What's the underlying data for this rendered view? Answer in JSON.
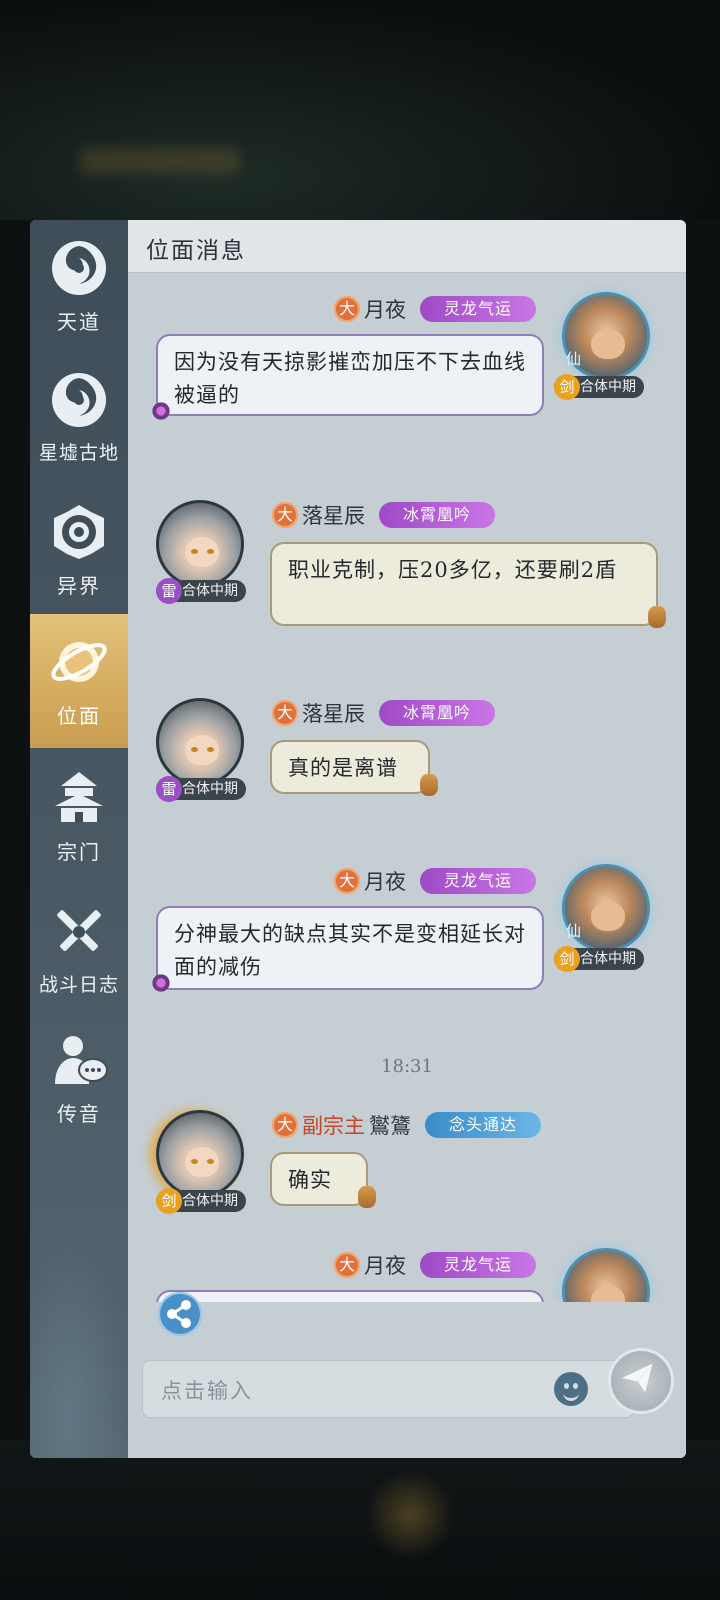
{
  "panel_title": "位面消息",
  "sidebar": {
    "items": [
      {
        "label": "天道",
        "icon": "swirl-icon",
        "active": false
      },
      {
        "label": "星墟古地",
        "icon": "swirl-icon",
        "active": false
      },
      {
        "label": "异界",
        "icon": "portal-icon",
        "active": false
      },
      {
        "label": "位面",
        "icon": "planet-icon",
        "active": true
      },
      {
        "label": "宗门",
        "icon": "pagoda-icon",
        "active": false
      },
      {
        "label": "战斗日志",
        "icon": "crossed-swords-icon",
        "active": false
      },
      {
        "label": "传音",
        "icon": "chat-person-icon",
        "active": false
      }
    ]
  },
  "messages": [
    {
      "side": "right",
      "badge": "大",
      "role": "",
      "name": "月夜",
      "title": "灵龙气运",
      "title_color": "purple",
      "rank_icon": "剑",
      "rank": "合体中期",
      "text": "因为没有天掠影摧峦加压不下去血线被逼的"
    },
    {
      "side": "left",
      "badge": "大",
      "role": "",
      "name": "落星辰",
      "title": "冰霄凰吟",
      "title_color": "purple",
      "rank_icon": "雷",
      "rank": "合体中期",
      "text": "职业克制，压20多亿，还要刷2盾"
    },
    {
      "side": "left",
      "badge": "大",
      "role": "",
      "name": "落星辰",
      "title": "冰霄凰吟",
      "title_color": "purple",
      "rank_icon": "雷",
      "rank": "合体中期",
      "text": "真的是离谱"
    },
    {
      "side": "right",
      "badge": "大",
      "role": "",
      "name": "月夜",
      "title": "灵龙气运",
      "title_color": "purple",
      "rank_icon": "剑",
      "rank": "合体中期",
      "text": "分神最大的缺点其实不是变相延长对面的减伤"
    },
    {
      "side": "left",
      "badge": "大",
      "role": "副宗主",
      "name": "鸑鷟",
      "title": "念头通达",
      "title_color": "blue",
      "rank_icon": "剑",
      "rank": "合体中期",
      "text": "确实"
    },
    {
      "side": "right",
      "badge": "大",
      "role": "",
      "name": "月夜",
      "title": "灵龙气运",
      "title_color": "purple",
      "rank_icon": "",
      "rank": "",
      "text": ""
    }
  ],
  "timestamp": "18:31",
  "avatar_badge": "仙",
  "input": {
    "placeholder": "点击输入"
  },
  "colors": {
    "accent_gold": "#d2aa5c",
    "badge_purple": "#b05fd6",
    "badge_blue": "#4a9fd8",
    "sword_orange": "#e8a21e",
    "thunder_purple": "#9a4fc7"
  }
}
